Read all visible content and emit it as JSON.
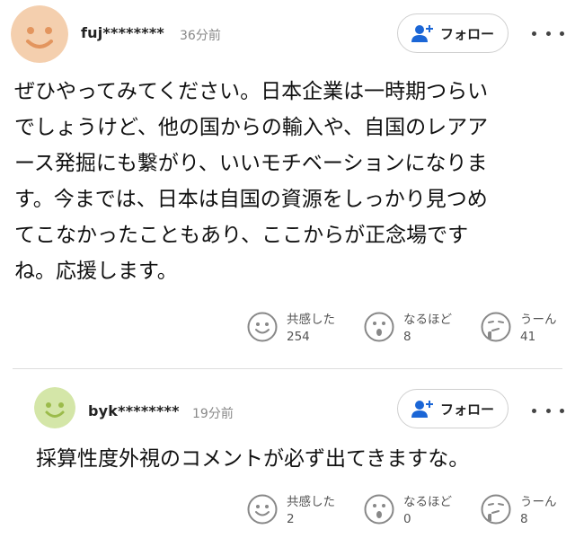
{
  "comments": [
    {
      "username": "fuj********",
      "time": "36分前",
      "follow_label": "フォロー",
      "avatar_color": "#f4cfae",
      "lines": [
        "ぜひやってみてください。日本企業は一時期つらい",
        "でしょうけど、他の国からの輸入や、自国のレアア",
        "ース発掘にも繋がり、いいモチベーションになりま",
        "す。今までは、日本は自国の資源をしっかり見つめ",
        "てこなかったこともあり、ここからが正念場です",
        "ね。応援します。"
      ],
      "reactions": [
        {
          "label": "共感した",
          "count": "254",
          "icon": "smile-icon"
        },
        {
          "label": "なるほど",
          "count": "8",
          "icon": "surprised-icon"
        },
        {
          "label": "うーん",
          "count": "41",
          "icon": "thinking-icon"
        }
      ]
    },
    {
      "username": "byk********",
      "time": "19分前",
      "follow_label": "フォロー",
      "avatar_color": "#d4e6a8",
      "lines": [
        "採算性度外視のコメントが必ず出てきますな。"
      ],
      "reactions": [
        {
          "label": "共感した",
          "count": "2",
          "icon": "smile-icon"
        },
        {
          "label": "なるほど",
          "count": "0",
          "icon": "surprised-icon"
        },
        {
          "label": "うーん",
          "count": "8",
          "icon": "thinking-icon"
        }
      ]
    }
  ],
  "colors": {
    "follow_icon": "#1b66d6",
    "reaction_icon": "#888888"
  }
}
